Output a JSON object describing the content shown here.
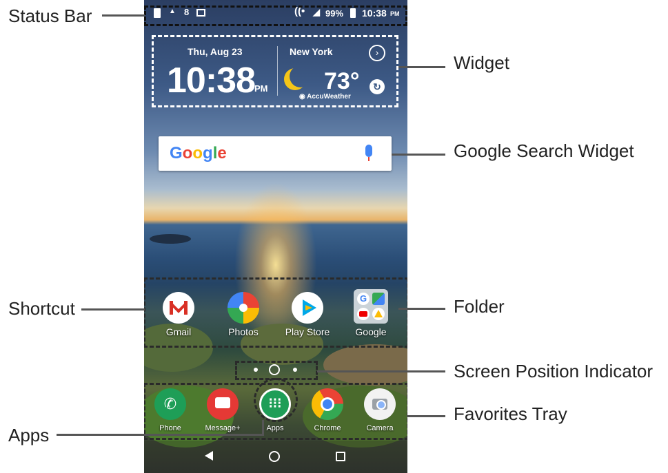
{
  "callouts": {
    "status_bar": "Status Bar",
    "widget": "Widget",
    "google_search_widget": "Google Search Widget",
    "shortcut": "Shortcut",
    "folder": "Folder",
    "screen_position_indicator": "Screen Position Indicator",
    "favorites_tray": "Favorites Tray",
    "apps": "Apps"
  },
  "status_bar": {
    "battery": "99%",
    "time": "10:38",
    "time_ampm": "PM"
  },
  "widget": {
    "date": "Thu, Aug 23",
    "time": "10:38",
    "ampm": "PM",
    "city": "New York",
    "temperature": "73°",
    "provider": "AccuWeather"
  },
  "search": {
    "logo_letters": [
      "G",
      "o",
      "o",
      "g",
      "l",
      "e"
    ],
    "logo_colors": [
      "#4285F4",
      "#EA4335",
      "#FBBC05",
      "#4285F4",
      "#34A853",
      "#EA4335"
    ],
    "mic_icon": "mic-icon"
  },
  "shortcuts": [
    {
      "label": "Gmail",
      "icon": "gmail-icon"
    },
    {
      "label": "Photos",
      "icon": "photos-icon"
    },
    {
      "label": "Play Store",
      "icon": "play-store-icon"
    },
    {
      "label": "Google",
      "icon": "google-folder-icon"
    }
  ],
  "favorites": [
    {
      "label": "Phone",
      "icon": "phone-icon",
      "color": "#1e9e57"
    },
    {
      "label": "Message+",
      "icon": "message-icon",
      "color": "#e53935"
    },
    {
      "label": "Apps",
      "icon": "apps-icon",
      "color": "#1e9e57"
    },
    {
      "label": "Chrome",
      "icon": "chrome-icon",
      "color": "#ffffff"
    },
    {
      "label": "Camera",
      "icon": "camera-icon",
      "color": "#ffffff"
    }
  ],
  "nav": {
    "back": "back-icon",
    "home": "home-icon",
    "recents": "recents-icon"
  }
}
